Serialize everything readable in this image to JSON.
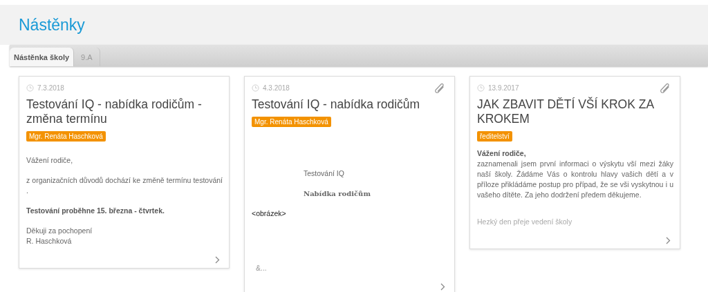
{
  "page_title": "Nástěnky",
  "tabs": [
    {
      "label": "Nástěnka školy",
      "selected": true
    },
    {
      "label": "9.A",
      "selected": false
    }
  ],
  "cards": [
    {
      "date": "7.3.2018",
      "title": "Testování IQ - nabídka rodičům - změna termínu",
      "attachment": false,
      "tag": "Mgr. Renáta Haschková",
      "body": [
        {
          "kind": "text",
          "lines": [
            "Vážení rodiče,"
          ]
        },
        {
          "kind": "justified",
          "lines": [
            "z organizačních důvodů dochází ke změně termínu testování ."
          ]
        },
        {
          "kind": "bold",
          "lines": [
            "Testování proběhne 15. března - čtvrtek."
          ]
        },
        {
          "kind": "text",
          "lines": [
            "Děkuji za pochopení",
            "R. Haschková"
          ]
        }
      ]
    },
    {
      "date": "4.3.2018",
      "title": "Testování IQ - nabídka rodičům",
      "attachment": true,
      "tag": "Mgr. Renáta Haschková",
      "body": [
        {
          "kind": "indented",
          "lines": [
            "Testování IQ"
          ]
        },
        {
          "kind": "serif",
          "lines": [
            "Nabídka rodičům"
          ]
        },
        {
          "kind": "dark",
          "lines": [
            "<obrázek>"
          ]
        },
        {
          "kind": "ellipsis",
          "lines": [
            "&..."
          ]
        }
      ]
    },
    {
      "date": "13.9.2017",
      "title": "JAK ZBAVIT DĚTÍ VŠÍ KROK ZA KROKEM",
      "attachment": true,
      "tag": "ředitelství",
      "body": [
        {
          "kind": "lead",
          "lines": [
            "Vážení rodiče,"
          ]
        },
        {
          "kind": "justified",
          "lines": [
            "zaznamenali jsem první informaci o výskytu vší mezi žáky naší školy. Žádáme Vás o kontrolu hlavy vašich dětí a v příloze přikládáme postup pro případ, že se vši vyskytnou i u vašeho dítěte. Za jeho dodržení předem děkujeme."
          ]
        },
        {
          "kind": "muted",
          "lines": [
            "Hezký den přeje vedení školy"
          ]
        }
      ]
    }
  ]
}
